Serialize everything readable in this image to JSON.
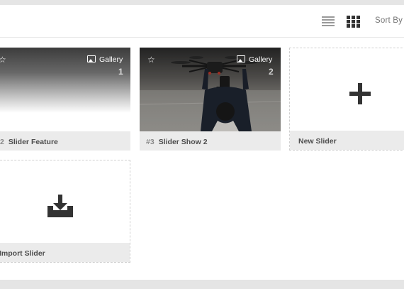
{
  "toolbar": {
    "list_view_icon": "list-view-icon",
    "grid_view_icon": "grid-view-icon",
    "sort_label": "Sort By"
  },
  "sliders": [
    {
      "star_icon": "star-outline-icon",
      "type_label": "Gallery",
      "type_icon": "image-icon",
      "slide_count": "1",
      "number": "2",
      "title": "Slider Feature"
    },
    {
      "star_icon": "star-outline-icon",
      "type_label": "Gallery",
      "type_icon": "image-icon",
      "slide_count": "2",
      "number": "#3",
      "title": "Slider Show 2"
    }
  ],
  "new_slider": {
    "icon": "plus-icon",
    "label": "New Slider"
  },
  "import_slider": {
    "icon": "import-tray-icon",
    "label": "Import Slider"
  },
  "colors": {
    "background": "#e5e5e5",
    "panel": "#ffffff",
    "footer": "#ebebeb",
    "icon_dark": "#333333"
  }
}
